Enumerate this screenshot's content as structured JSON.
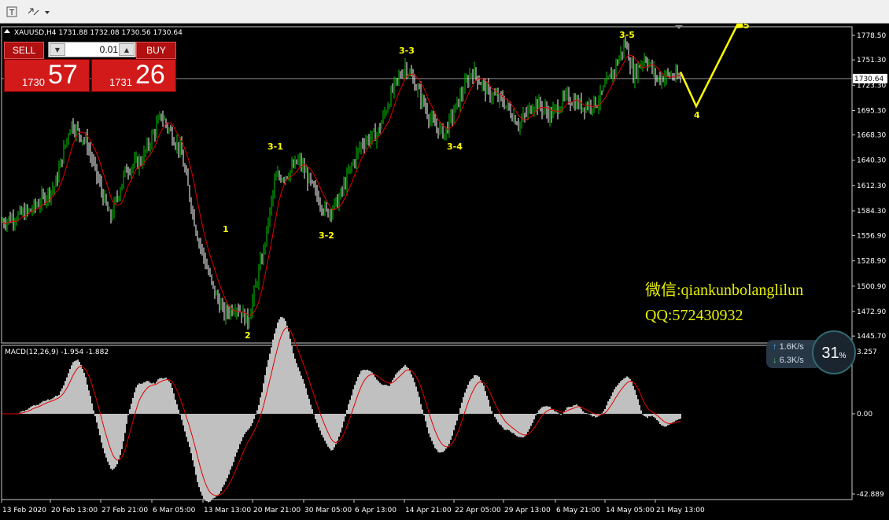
{
  "toolbar": {
    "text_tool_icon": "text-cursor-icon",
    "objects_tool_icon": "arrows-icon"
  },
  "chart": {
    "header": "XAUUSD,H4  1731.88 1732.08 1730.56 1730.64",
    "current_price": "1730.64",
    "price_axis": [
      "1778.50",
      "1751.30",
      "1723.30",
      "1695.30",
      "1668.30",
      "1640.30",
      "1612.30",
      "1584.30",
      "1556.90",
      "1528.90",
      "1500.90",
      "1472.90",
      "1445.70"
    ],
    "macd_label": "MACD(12,26,9) -1.954 -1.882",
    "macd_axis": [
      "3.257",
      "0.00",
      "-42.889"
    ],
    "time_axis": [
      "13 Feb 2020",
      "20 Feb 13:00",
      "27 Feb 21:00",
      "6 Mar 05:00",
      "13 Mar 13:00",
      "20 Mar 21:00",
      "30 Mar 05:00",
      "6 Apr 13:00",
      "14 Apr 21:00",
      "22 Apr 05:00",
      "29 Apr 13:00",
      "6 May 21:00",
      "14 May 05:00",
      "21 May 13:00"
    ],
    "wave_labels": [
      "1",
      "2",
      "3-1",
      "3-2",
      "3-3",
      "3-4",
      "3-5",
      "4",
      "5"
    ],
    "colors": {
      "bull": "#00c800",
      "bear": "#ffffff",
      "ma": "#e00000",
      "wave": "#ffff00",
      "macd_hist": "#c0c0c0",
      "macd_signal": "#e00000",
      "grid": "#c8c8c8"
    }
  },
  "one_click": {
    "sell_label": "SELL",
    "buy_label": "BUY",
    "lot": "0.01",
    "sell_price_prefix": "1730",
    "sell_price_big": "57",
    "buy_price_prefix": "1731",
    "buy_price_big": "26"
  },
  "watermark": {
    "wechat": "微信:qiankunbolanglilun",
    "qq": "QQ:572430932"
  },
  "net_widget": {
    "upload": "1.6K/s",
    "download": "6.3K/s",
    "percent": "31",
    "percent_sign": "%"
  },
  "chart_data": {
    "type": "line",
    "x": [
      "13 Feb 2020",
      "20 Feb 13:00",
      "27 Feb 21:00",
      "6 Mar 05:00",
      "13 Mar 13:00",
      "20 Mar 21:00",
      "30 Mar 05:00",
      "6 Apr 13:00",
      "14 Apr 21:00",
      "22 Apr 05:00",
      "29 Apr 13:00",
      "6 May 21:00",
      "14 May 05:00",
      "21 May 13:00"
    ],
    "series": [
      {
        "name": "XAUUSD,H4",
        "values": [
          1570,
          1620,
          1600,
          1680,
          1470,
          1570,
          1590,
          1650,
          1730,
          1720,
          1705,
          1700,
          1740,
          1730
        ]
      }
    ],
    "ylim": [
      1445.7,
      1778.5
    ]
  }
}
